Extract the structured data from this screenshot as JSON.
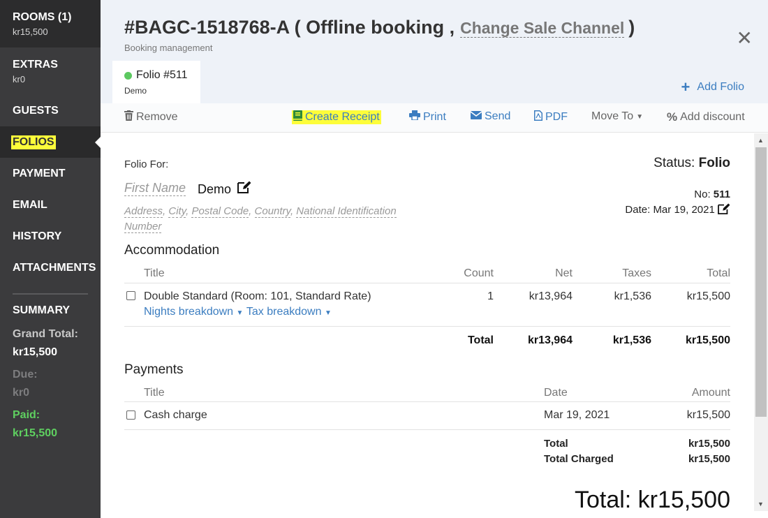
{
  "sidebar": {
    "rooms_label": "ROOMS (1)",
    "rooms_value": "kr15,500",
    "extras_label": "EXTRAS",
    "extras_value": "kr0",
    "guests": "GUESTS",
    "folios": "FOLIOS",
    "payment": "PAYMENT",
    "email": "EMAIL",
    "history": "HISTORY",
    "attachments": "ATTACHMENTS",
    "summary": "SUMMARY",
    "grand_total_label": "Grand Total:",
    "grand_total_value": "kr15,500",
    "due_label": "Due:",
    "due_value": "kr0",
    "paid_label": "Paid:",
    "paid_value": "kr15,500"
  },
  "header": {
    "booking_id": "#BAGC-1518768-A ( Offline booking ,",
    "change_channel": "Change Sale Channel",
    "close_paren": ")",
    "subtitle": "Booking management",
    "tab_title": "Folio #511",
    "tab_sub": "Demo",
    "add_folio": "Add Folio"
  },
  "toolbar": {
    "remove": "Remove",
    "create_receipt": "Create Receipt",
    "print": "Print",
    "send": "Send",
    "pdf": "PDF",
    "move_to": "Move To",
    "add_discount": "Add discount"
  },
  "folio": {
    "folio_for": "Folio For:",
    "status_label": "Status:",
    "status_value": "Folio",
    "first_name_label": "First Name",
    "first_name_value": "Demo",
    "address_fields": [
      "Address",
      "City",
      "Postal Code",
      "Country",
      "National Identification Number"
    ],
    "no_label": "No:",
    "no_value": "511",
    "date_label": "Date:",
    "date_value": "Mar 19, 2021"
  },
  "accommodation": {
    "heading": "Accommodation",
    "columns": [
      "Title",
      "Count",
      "Net",
      "Taxes",
      "Total"
    ],
    "row": {
      "title": "Double Standard (Room: 101, Standard Rate)",
      "count": "1",
      "net": "kr13,964",
      "taxes": "kr1,536",
      "total": "kr15,500",
      "nights_link": "Nights breakdown",
      "tax_link": "Tax breakdown"
    },
    "total_label": "Total",
    "total_net": "kr13,964",
    "total_taxes": "kr1,536",
    "total_total": "kr15,500"
  },
  "payments": {
    "heading": "Payments",
    "columns": [
      "Title",
      "Date",
      "Amount"
    ],
    "row": {
      "title": "Cash charge",
      "date": "Mar 19, 2021",
      "amount": "kr15,500"
    },
    "total_label": "Total",
    "total_value": "kr15,500",
    "total_charged_label": "Total Charged",
    "total_charged_value": "kr15,500"
  },
  "grand_total": "Total: kr15,500",
  "colors": {
    "accent": "#3b7dc0",
    "highlight": "#fdfd3a",
    "sidebar": "#3b3b3d",
    "paid": "#5fd060"
  }
}
